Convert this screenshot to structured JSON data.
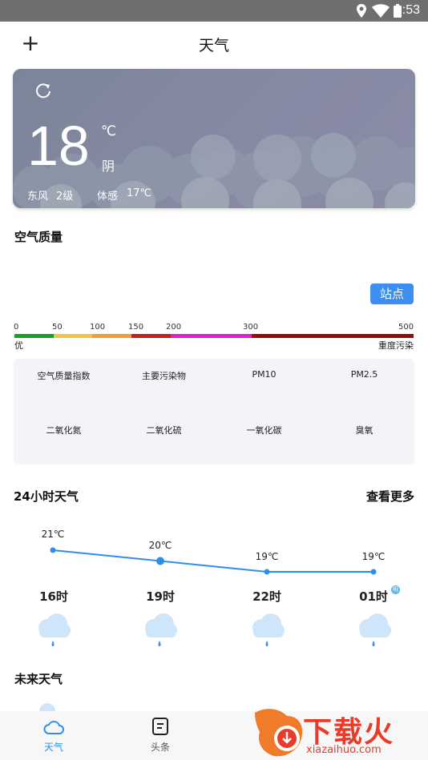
{
  "status_bar": {
    "time": "1:53",
    "icons": [
      "location-icon",
      "wifi-icon",
      "battery-icon"
    ]
  },
  "header": {
    "add_icon": "+",
    "title": "天气"
  },
  "current": {
    "temperature": "18",
    "unit": "℃",
    "condition": "阴",
    "wind_dir": "东风",
    "wind_level": "2级",
    "feels_label": "体感",
    "feels_value": "17℃"
  },
  "air_quality": {
    "title": "空气质量",
    "station_button": "站点",
    "scale": [
      "0",
      "50",
      "100",
      "150",
      "200",
      "300",
      "500"
    ],
    "scale_colors": [
      "#19a028",
      "#f5c340",
      "#f0a030",
      "#c52020",
      "#e020d0",
      "#9b0a0a"
    ],
    "best_label": "优",
    "worst_label": "重度污染",
    "metrics": [
      "空气质量指数",
      "主要污染物",
      "PM10",
      "PM2.5",
      "二氧化氮",
      "二氧化硫",
      "一氧化碳",
      "臭氧"
    ]
  },
  "hourly": {
    "title": "24小时天气",
    "more": "查看更多",
    "hours": [
      {
        "time": "16时",
        "temp": "21℃",
        "value": 21
      },
      {
        "time": "19时",
        "temp": "20℃",
        "value": 20
      },
      {
        "time": "22时",
        "temp": "19℃",
        "value": 19
      },
      {
        "time": "01时",
        "temp": "19℃",
        "value": 19,
        "badge": "明"
      }
    ],
    "line_color": "#2f8fe8"
  },
  "future": {
    "title": "未来天气"
  },
  "nav": {
    "items": [
      {
        "label": "天气",
        "icon": "cloud-icon",
        "active": true
      },
      {
        "label": "头条",
        "icon": "news-icon",
        "active": false
      }
    ],
    "active_color": "#2f8fe8"
  },
  "watermark": {
    "text": "下载火",
    "url": "xiazaihuo.com"
  }
}
